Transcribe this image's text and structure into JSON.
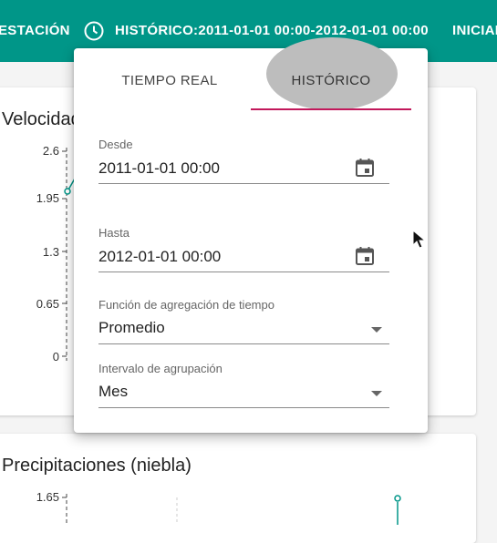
{
  "toolbar": {
    "station_label": "ESTACIÓN",
    "historic_label": "HISTÓRICO:2011-01-01 00:00-2012-01-01 00:00",
    "start_label": "INICIAL"
  },
  "cards": {
    "wind": {
      "title": "Velocidad",
      "ticks": [
        "2.6",
        "1.95",
        "1.3",
        "0.65",
        "0"
      ]
    },
    "precip": {
      "title": "Precipitaciones (niebla)",
      "ticks": [
        "1.65"
      ]
    }
  },
  "popup": {
    "tabs": {
      "realtime": "TIEMPO REAL",
      "historic": "HISTÓRICO"
    },
    "from": {
      "label": "Desde",
      "value": "2011-01-01 00:00"
    },
    "to": {
      "label": "Hasta",
      "value": "2012-01-01 00:00"
    },
    "aggregation": {
      "label": "Función de agregación de tiempo",
      "value": "Promedio"
    },
    "interval": {
      "label": "Intervalo de agrupación",
      "value": "Mes"
    }
  },
  "colors": {
    "toolbar": "#009688",
    "tab_indicator": "#c2185b",
    "series": "#009688"
  }
}
